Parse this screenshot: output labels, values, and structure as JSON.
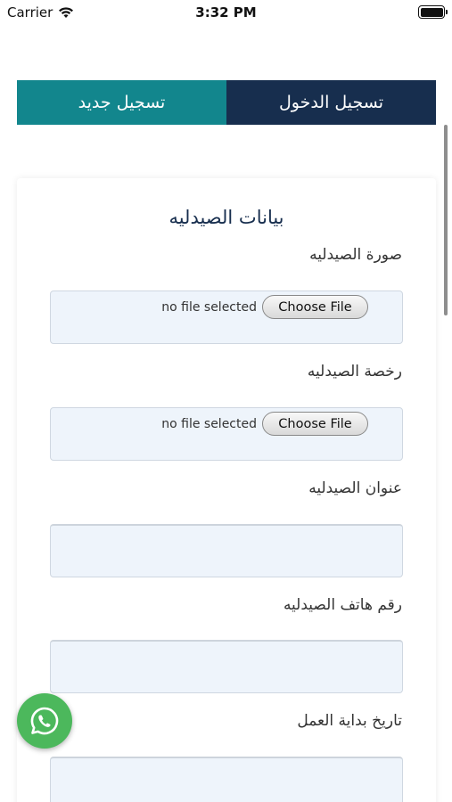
{
  "status_bar": {
    "carrier": "Carrier",
    "time": "3:32 PM"
  },
  "tabs": [
    {
      "label": "تسجيل جديد",
      "active": true
    },
    {
      "label": "تسجيل الدخول",
      "active": false
    }
  ],
  "form": {
    "title": "بيانات الصيدليه",
    "fields": [
      {
        "label": "صورة الصيدليه",
        "type": "file",
        "status": "no file selected",
        "button": "Choose File"
      },
      {
        "label": "رخصة الصيدليه",
        "type": "file",
        "status": "no file selected",
        "button": "Choose File"
      },
      {
        "label": "عنوان الصيدليه",
        "type": "text",
        "value": "",
        "placeholder": ""
      },
      {
        "label": "رقم هاتف الصيدليه",
        "type": "text",
        "value": "",
        "placeholder": ""
      },
      {
        "label": "تاريخ بداية العمل",
        "type": "text",
        "value": "",
        "placeholder": ""
      }
    ]
  },
  "colors": {
    "tab_register": "#12868d",
    "tab_login": "#172e4e",
    "whatsapp": "#4cb85c",
    "input_bg": "#eef4fb"
  },
  "icons": {
    "whatsapp": "whatsapp-icon",
    "wifi": "wifi-icon",
    "battery": "battery-icon"
  }
}
